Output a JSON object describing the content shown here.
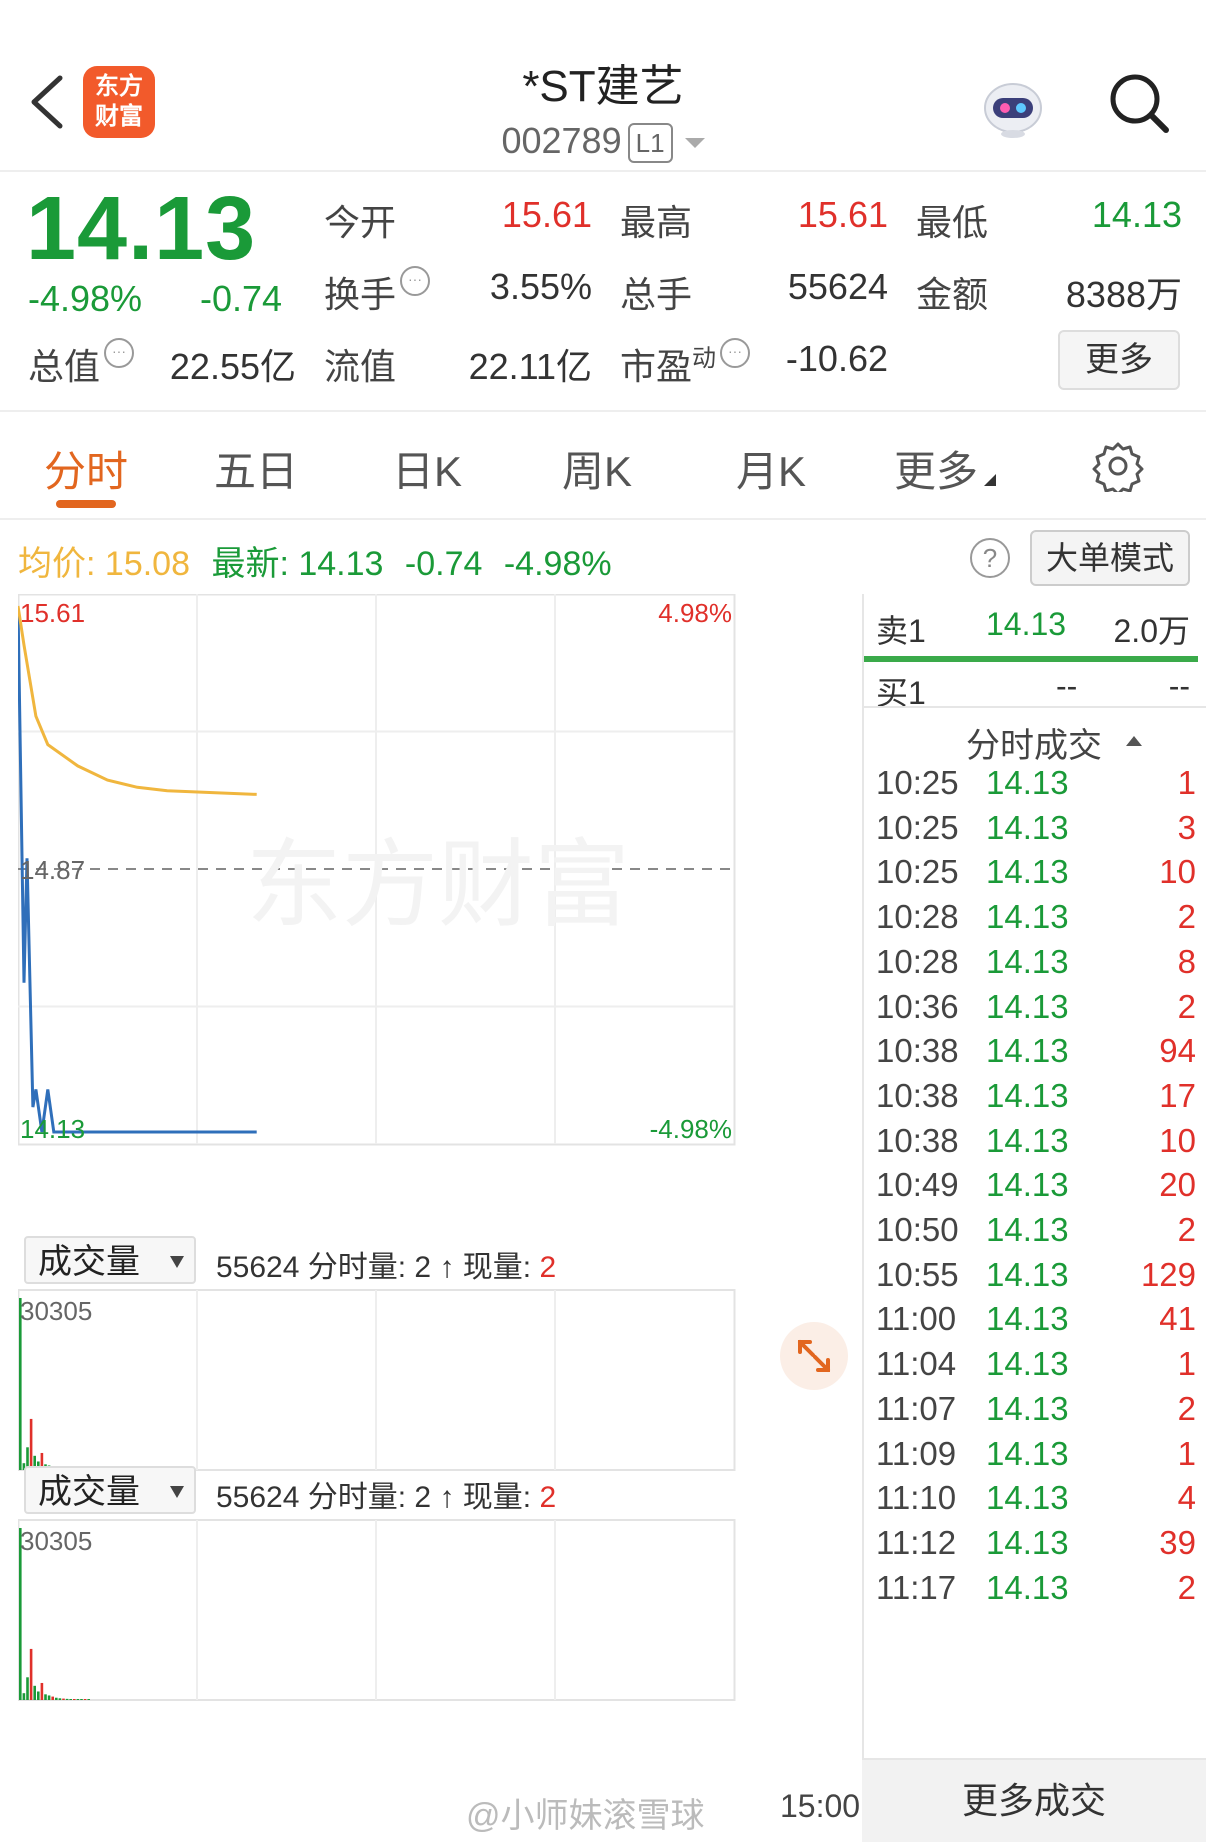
{
  "header": {
    "title": "*ST建艺",
    "code": "002789",
    "level_badge": "L1",
    "logo_text": "东方财富"
  },
  "quote": {
    "price": "14.13",
    "change_pct": "-4.98%",
    "change_abs": "-0.74",
    "open_label": "今开",
    "open": "15.61",
    "high_label": "最高",
    "high": "15.61",
    "low_label": "最低",
    "low": "14.13",
    "turnover_label": "换手",
    "turnover": "3.55%",
    "volume_label": "总手",
    "volume": "55624",
    "amount_label": "金额",
    "amount": "8388万",
    "mktcap_label": "总值",
    "mktcap": "22.55亿",
    "float_label": "流值",
    "float_cap": "22.11亿",
    "pe_label": "市盈",
    "pe_sup": "动",
    "pe": "-10.62",
    "more_button": "更多"
  },
  "tabs": [
    "分时",
    "五日",
    "日K",
    "周K",
    "月K",
    "更多"
  ],
  "avg_line": {
    "avg_label": "均价:",
    "avg": "15.08",
    "latest_label": "最新:",
    "latest": "14.13",
    "chg": "-0.74",
    "pct": "-4.98%",
    "big_order_button": "大单模式"
  },
  "chart_data": {
    "type": "line",
    "y_axis_left": [
      "15.61",
      "14.87",
      "14.13"
    ],
    "y_axis_right": [
      "4.98%",
      "-4.98%"
    ],
    "ylim": [
      14.13,
      15.61
    ],
    "preclose": 14.87,
    "series": [
      {
        "color": "#2f6fba",
        "x": [
          0,
          2,
          3,
          5,
          6,
          8,
          10,
          12,
          20,
          80
        ],
        "y": [
          15.61,
          14.55,
          14.9,
          14.2,
          14.25,
          14.13,
          14.25,
          14.13,
          14.13,
          14.13
        ]
      },
      {
        "color": "#f0b63e",
        "x": [
          0,
          2,
          6,
          10,
          20,
          30,
          40,
          50,
          80
        ],
        "y": [
          15.61,
          15.5,
          15.3,
          15.22,
          15.16,
          15.12,
          15.1,
          15.09,
          15.08
        ]
      }
    ],
    "volume": {
      "max_label": "30305",
      "bars": [
        30305,
        1200,
        4000,
        9000,
        2500,
        1500,
        3000,
        1000,
        800,
        600,
        400,
        300,
        250,
        200,
        150,
        100,
        100,
        80,
        60,
        50
      ]
    },
    "x_end_label": "15:00"
  },
  "volume_panels": [
    {
      "select_label": "成交量",
      "info_prefix": "55624 分时量: 2 ↑ 现量: ",
      "info_value": "2"
    },
    {
      "select_label": "成交量",
      "info_prefix": "55624 分时量: 2 ↑ 现量: ",
      "info_value": "2"
    }
  ],
  "orderbook": {
    "sell1_label": "卖1",
    "sell1_price": "14.13",
    "sell1_vol": "2.0万",
    "buy1_label": "买1",
    "buy1_price": "--",
    "buy1_vol": "--"
  },
  "trades": {
    "title": "分时成交",
    "rows": [
      {
        "t": "10:25",
        "p": "14.13",
        "v": "1"
      },
      {
        "t": "10:25",
        "p": "14.13",
        "v": "3"
      },
      {
        "t": "10:25",
        "p": "14.13",
        "v": "10"
      },
      {
        "t": "10:28",
        "p": "14.13",
        "v": "2"
      },
      {
        "t": "10:28",
        "p": "14.13",
        "v": "8"
      },
      {
        "t": "10:36",
        "p": "14.13",
        "v": "2"
      },
      {
        "t": "10:38",
        "p": "14.13",
        "v": "94"
      },
      {
        "t": "10:38",
        "p": "14.13",
        "v": "17"
      },
      {
        "t": "10:38",
        "p": "14.13",
        "v": "10"
      },
      {
        "t": "10:49",
        "p": "14.13",
        "v": "20"
      },
      {
        "t": "10:50",
        "p": "14.13",
        "v": "2"
      },
      {
        "t": "10:55",
        "p": "14.13",
        "v": "129"
      },
      {
        "t": "11:00",
        "p": "14.13",
        "v": "41"
      },
      {
        "t": "11:04",
        "p": "14.13",
        "v": "1"
      },
      {
        "t": "11:07",
        "p": "14.13",
        "v": "2"
      },
      {
        "t": "11:09",
        "p": "14.13",
        "v": "1"
      },
      {
        "t": "11:10",
        "p": "14.13",
        "v": "4"
      },
      {
        "t": "11:12",
        "p": "14.13",
        "v": "39"
      },
      {
        "t": "11:17",
        "p": "14.13",
        "v": "2"
      }
    ],
    "more_button": "更多成交"
  },
  "watermark": "@小师妹滚雪球",
  "chart_watermark": "东方财富",
  "icons": {
    "back": "chevron-left-icon",
    "robot": "robot-icon",
    "search": "search-icon",
    "settings": "gear-icon",
    "help": "question-icon",
    "expand": "expand-icon"
  },
  "colors": {
    "up": "#e0302a",
    "down": "#1a9a38",
    "accent": "#e2661f",
    "price_line": "#2f6fba",
    "avg_line": "#f0b63e"
  }
}
